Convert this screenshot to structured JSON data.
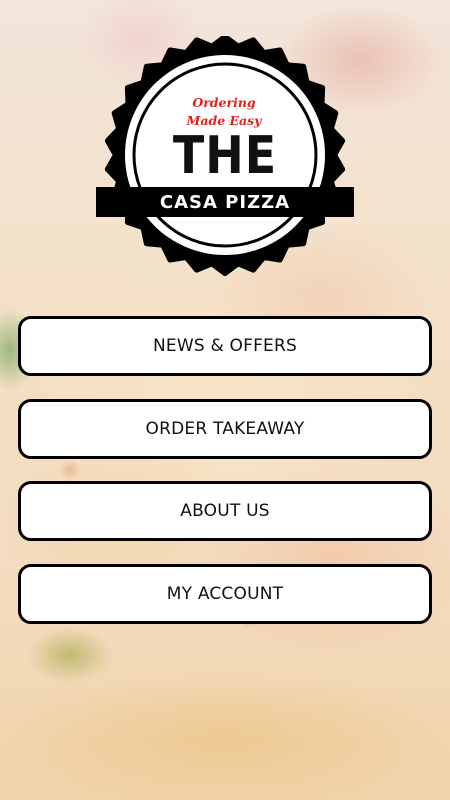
{
  "logo": {
    "tagline": "Ordering Made Easy",
    "title": "THE",
    "name": "CASA PIZZA"
  },
  "menu": {
    "items": [
      {
        "label": "NEWS & OFFERS"
      },
      {
        "label": "ORDER TAKEAWAY"
      },
      {
        "label": "ABOUT US"
      },
      {
        "label": "MY ACCOUNT"
      }
    ]
  },
  "colors": {
    "tagline": "#e0201c",
    "badge": "#000000",
    "button_border": "#000000",
    "button_fill": "#ffffff"
  },
  "icons": [
    "scalloped-badge-logo"
  ]
}
